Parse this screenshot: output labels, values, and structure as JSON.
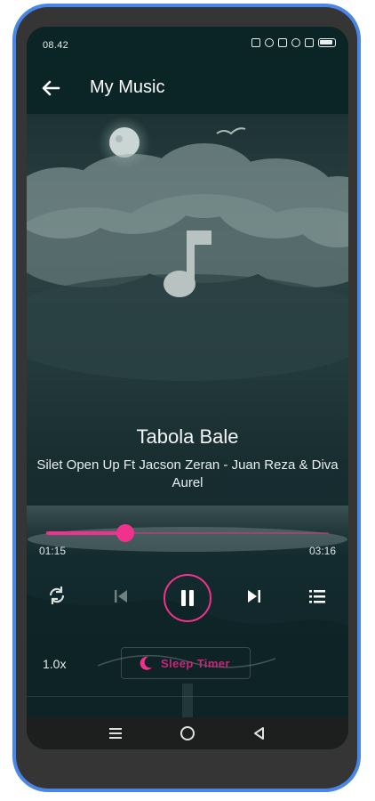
{
  "status_bar": {
    "time": "08.42"
  },
  "app_bar": {
    "title": "My Music"
  },
  "now_playing": {
    "title": "Tabola Bale",
    "artist": "Silet Open Up Ft Jacson Zeran - Juan Reza & Diva Aurel",
    "elapsed": "01:15",
    "duration": "03:16",
    "progress_fraction": 0.28,
    "is_playing": true
  },
  "controls": {
    "speed": "1.0x",
    "sleep_timer_label": "Sleep Timer",
    "repeat_icon": "repeat-icon",
    "prev_icon": "skip-previous-icon",
    "pause_icon": "pause-icon",
    "next_icon": "skip-next-icon",
    "queue_icon": "queue-list-icon"
  },
  "colors": {
    "accent": "#f0328c",
    "app_bar": "#0b2426",
    "phone_frame": "#4a86e8"
  }
}
